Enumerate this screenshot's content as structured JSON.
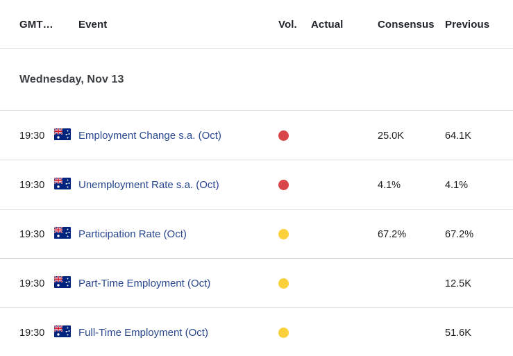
{
  "table": {
    "columns": {
      "time": "GMT…",
      "event": "Event",
      "volatility": "Vol.",
      "actual": "Actual",
      "consensus": "Consensus",
      "previous": "Previous"
    },
    "date_group": "Wednesday, Nov 13",
    "rows": [
      {
        "time": "19:30",
        "country": "Australia",
        "flag_icon": "australia-flag-icon",
        "event": "Employment Change s.a. (Oct)",
        "volatility": "high",
        "volatility_icon": "volatility-dot-high",
        "actual": "",
        "consensus": "25.0K",
        "previous": "64.1K"
      },
      {
        "time": "19:30",
        "country": "Australia",
        "flag_icon": "australia-flag-icon",
        "event": "Unemployment Rate s.a. (Oct)",
        "volatility": "high",
        "volatility_icon": "volatility-dot-high",
        "actual": "",
        "consensus": "4.1%",
        "previous": "4.1%"
      },
      {
        "time": "19:30",
        "country": "Australia",
        "flag_icon": "australia-flag-icon",
        "event": "Participation Rate (Oct)",
        "volatility": "medium",
        "volatility_icon": "volatility-dot-medium",
        "actual": "",
        "consensus": "67.2%",
        "previous": "67.2%"
      },
      {
        "time": "19:30",
        "country": "Australia",
        "flag_icon": "australia-flag-icon",
        "event": "Part-Time Employment (Oct)",
        "volatility": "medium",
        "volatility_icon": "volatility-dot-medium",
        "actual": "",
        "consensus": "",
        "previous": "12.5K"
      },
      {
        "time": "19:30",
        "country": "Australia",
        "flag_icon": "australia-flag-icon",
        "event": "Full-Time Employment (Oct)",
        "volatility": "medium",
        "volatility_icon": "volatility-dot-medium",
        "actual": "",
        "consensus": "",
        "previous": "51.6K"
      }
    ]
  },
  "colors": {
    "link": "#28478e",
    "volatility_high": "#d9464a",
    "volatility_medium": "#fbd03b",
    "text": "#1a1c1f",
    "divider": "#d7dcdf"
  }
}
